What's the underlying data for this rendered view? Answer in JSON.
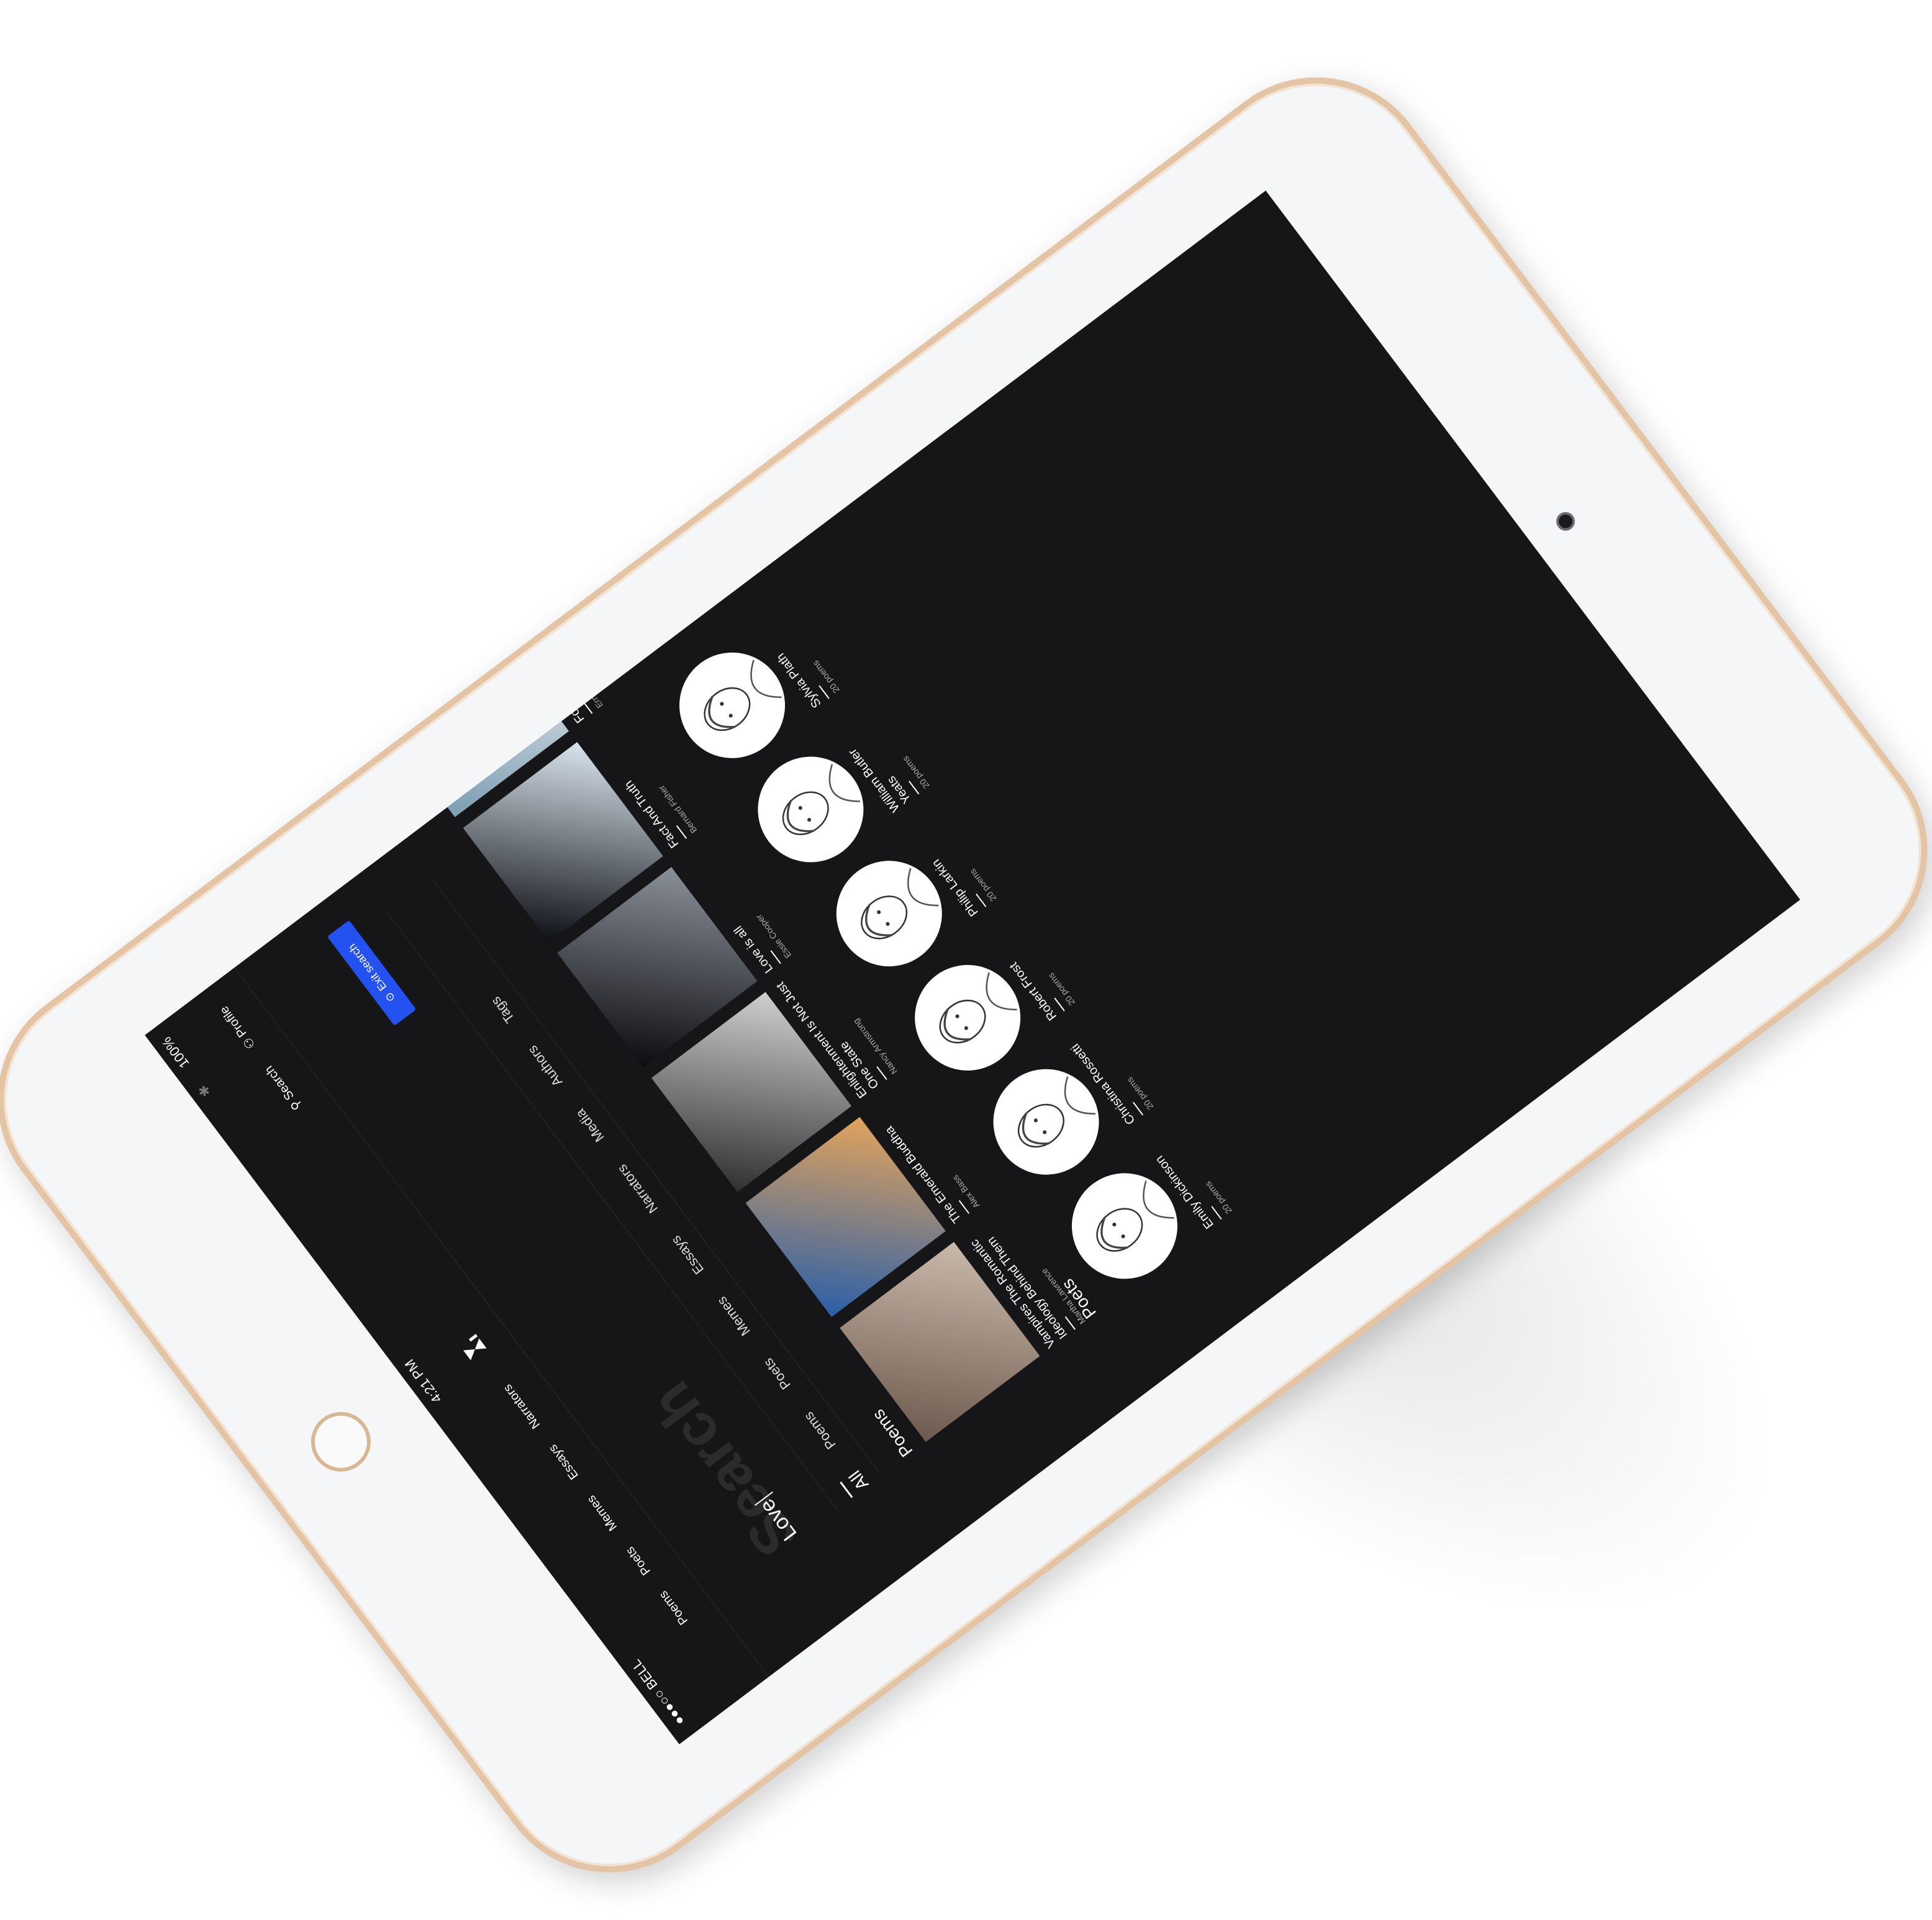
{
  "status_bar": {
    "carrier": "●●●○○ BELL",
    "time": "4:21 PM",
    "battery": "100%"
  },
  "top_nav": {
    "links": [
      "Poems",
      "Poets",
      "Memes",
      "Essays",
      "Narrators"
    ],
    "search_label": "Search",
    "profile_label": "Profile"
  },
  "search": {
    "watermark": "Search",
    "query": "Love",
    "exit_label": "Exit search"
  },
  "filters": [
    "All",
    "Poems",
    "Poets",
    "Memes",
    "Essays",
    "Narrators",
    "Media",
    "Authors",
    "Tags"
  ],
  "sections": {
    "poems": "Poems",
    "poets": "Poets"
  },
  "poems": [
    {
      "title": "Vampires The Romantic Ideology Behind Them",
      "author": "Martha Lawrence",
      "thumb_colors": [
        "#6d5a4e",
        "#c9b9ab"
      ]
    },
    {
      "title": "The Emerald Buddha",
      "author": "Alex Bass",
      "thumb_colors": [
        "#2a5fa8",
        "#e2a35c"
      ]
    },
    {
      "title": "Enlightenment Is Not Just One State",
      "author": "Nancy Armstrong",
      "thumb_colors": [
        "#303030",
        "#cfcfcf"
      ]
    },
    {
      "title": "Love is all",
      "author": "Essie Cooper",
      "thumb_colors": [
        "#0c0d10",
        "#8a8f99"
      ]
    },
    {
      "title": "Fact And Truth",
      "author": "Bernard Fisher",
      "thumb_colors": [
        "#0d0f14",
        "#d9e4ee"
      ]
    },
    {
      "title": "Food is love love is food",
      "author": "Ernest Floyd",
      "thumb_colors": [
        "#7c9db2",
        "#f0f2f4"
      ]
    }
  ],
  "poets": [
    {
      "name": "Emily Dickinson",
      "count": "20 poems"
    },
    {
      "name": "Christina Rossetti",
      "count": "20 poems"
    },
    {
      "name": "Robert Frost",
      "count": "20 poems"
    },
    {
      "name": "Philip Larkin",
      "count": "20 poems"
    },
    {
      "name": "William Butler Yeats",
      "count": "20 poems"
    },
    {
      "name": "Sylvia Plath",
      "count": "20 poems"
    }
  ],
  "colors": {
    "screen_bg": "#161618",
    "accent": "#2452f1",
    "bezel": "#f5f6f8",
    "frame": "#e3c5a6"
  },
  "icons": {
    "search": "search-icon",
    "profile": "profile-icon",
    "exit": "exit-icon",
    "logo": "hourglass-logo-icon"
  }
}
